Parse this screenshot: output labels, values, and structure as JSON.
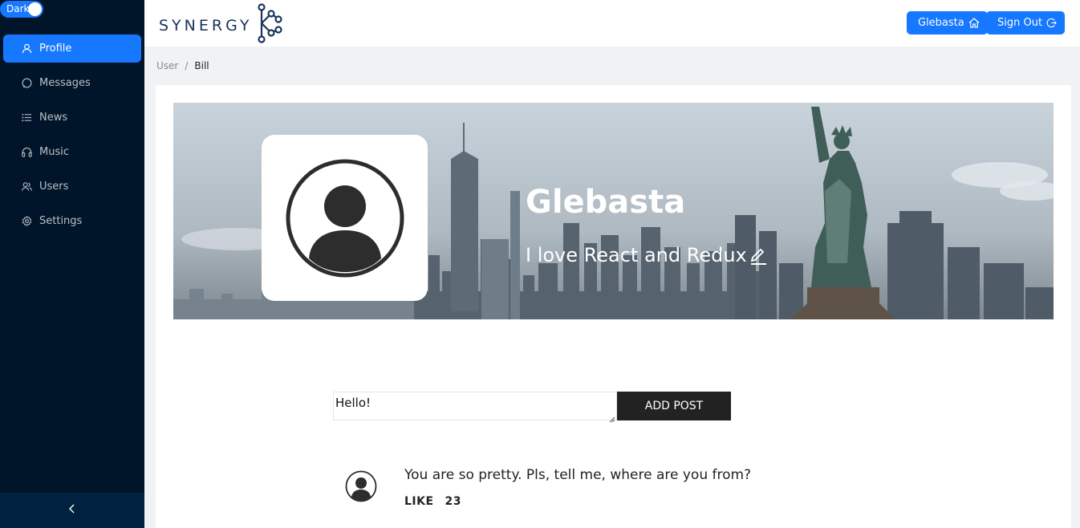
{
  "theme_toggle": {
    "label": "Dark"
  },
  "sidebar": {
    "items": [
      {
        "label": "Profile",
        "icon": "user-icon",
        "active": true
      },
      {
        "label": "Messages",
        "icon": "message-icon"
      },
      {
        "label": "News",
        "icon": "list-icon"
      },
      {
        "label": "Music",
        "icon": "headphones-icon"
      },
      {
        "label": "Users",
        "icon": "users-icon"
      },
      {
        "label": "Settings",
        "icon": "gear-icon"
      }
    ],
    "collapse_icon": "chevron-left-icon"
  },
  "header": {
    "logo_text": "SYNERGY",
    "user_button": {
      "label": "Glebasta",
      "icon": "home-icon"
    },
    "signout_button": {
      "label": "Sign Out",
      "icon": "logout-icon"
    }
  },
  "breadcrumb": {
    "root": "User",
    "separator": "/",
    "current": "Bill"
  },
  "profile": {
    "name": "Glebasta",
    "status": "I love React and Redux"
  },
  "composer": {
    "value": "Hello!",
    "button_label": "ADD POST"
  },
  "posts": [
    {
      "text": "You are so pretty. Pls, tell me, where are you from?",
      "like_label": "LIKE",
      "likes": "23"
    }
  ],
  "colors": {
    "accent": "#1677ff",
    "sidebar_bg": "#001529",
    "button_dark": "#222222"
  }
}
